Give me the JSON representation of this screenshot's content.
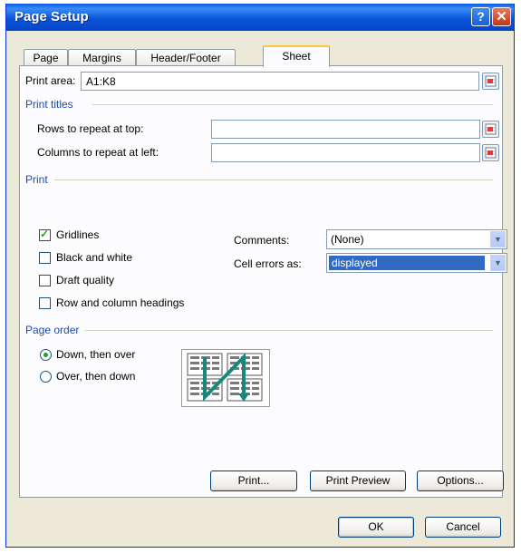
{
  "window": {
    "title": "Page Setup",
    "help_glyph": "?",
    "close_glyph": "✕"
  },
  "tabs": [
    {
      "label": "Page",
      "active": false
    },
    {
      "label": "Margins",
      "active": false
    },
    {
      "label": "Header/Footer",
      "active": false
    },
    {
      "label": "Sheet",
      "active": true
    }
  ],
  "print_area": {
    "label": "Print area:",
    "value": "A1:K8"
  },
  "print_titles": {
    "heading": "Print titles",
    "rows_label": "Rows to repeat at top:",
    "rows_value": "",
    "columns_label": "Columns to repeat at left:",
    "columns_value": ""
  },
  "print": {
    "heading": "Print",
    "gridlines": {
      "label": "Gridlines",
      "checked": true
    },
    "black_and_white": {
      "label": "Black and white",
      "checked": false
    },
    "draft_quality": {
      "label": "Draft quality",
      "checked": false
    },
    "row_col_headings": {
      "label": "Row and column headings",
      "checked": false
    },
    "comments": {
      "label": "Comments:",
      "value": "(None)"
    },
    "cell_errors": {
      "label": "Cell errors as:",
      "value": "displayed"
    }
  },
  "page_order": {
    "heading": "Page order",
    "down_then_over": {
      "label": "Down, then over",
      "selected": true
    },
    "over_then_down": {
      "label": "Over, then down",
      "selected": false
    }
  },
  "buttons": {
    "print": "Print...",
    "print_preview": "Print Preview",
    "options": "Options...",
    "ok": "OK",
    "cancel": "Cancel"
  },
  "colors": {
    "title_bar": "#0a55d8",
    "section_heading": "#1c49b6",
    "selection": "#316ac5",
    "check_mark": "#21a121"
  }
}
